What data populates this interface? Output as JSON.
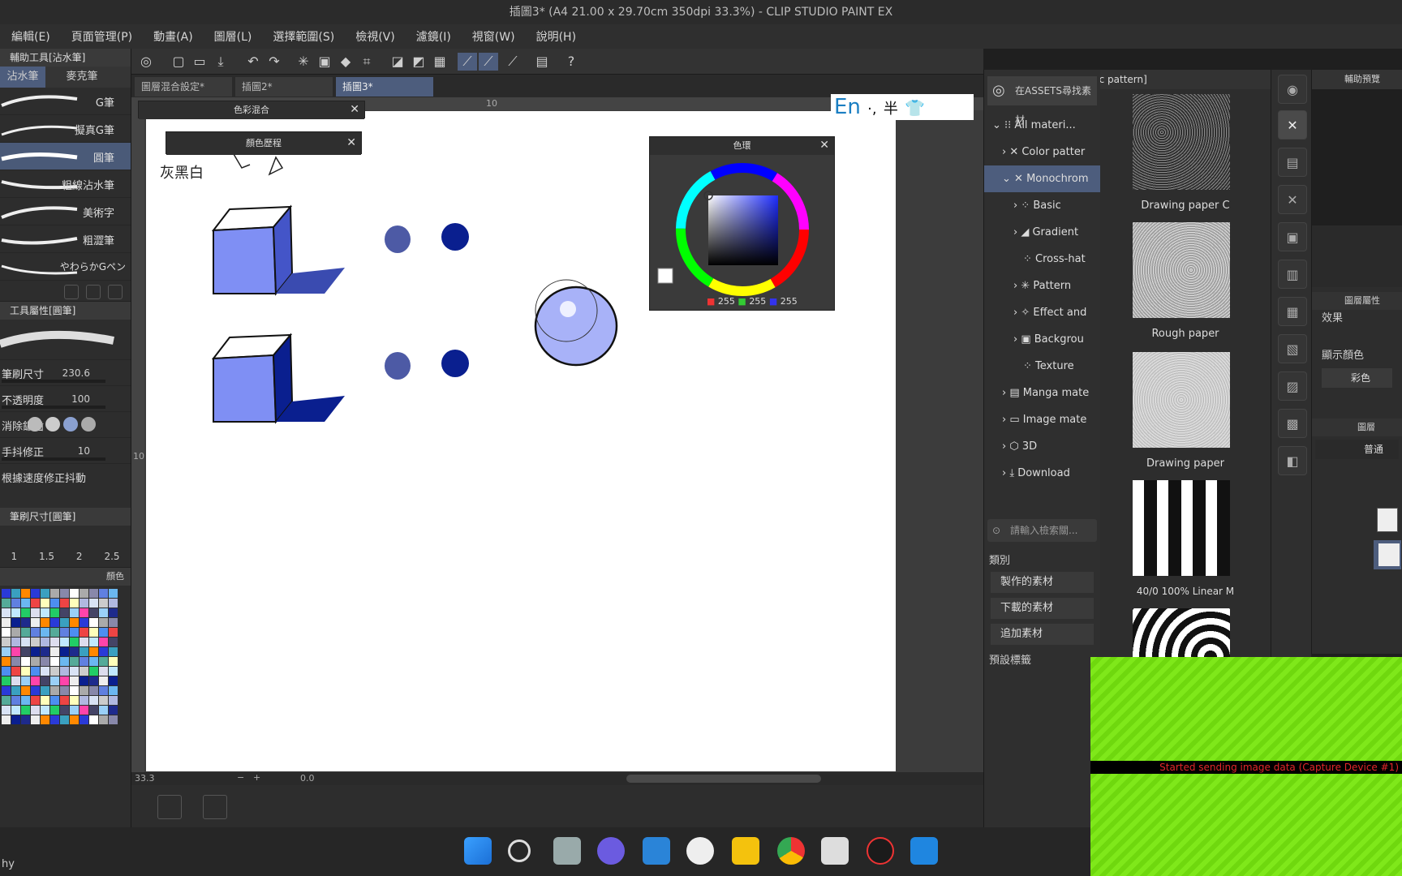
{
  "window": {
    "title": "插圖3* (A4 21.00 x 29.70cm 350dpi 33.3%) - CLIP STUDIO PAINT EX"
  },
  "menu": [
    "編輯(E)",
    "頁面管理(P)",
    "動畫(A)",
    "圖層(L)",
    "選擇範圍(S)",
    "檢視(V)",
    "濾鏡(I)",
    "視窗(W)",
    "說明(H)"
  ],
  "subtool_panel": {
    "title": "輔助工具[沾水筆]",
    "tabs": [
      "沾水筆",
      "麥克筆"
    ],
    "brushes": [
      "G筆",
      "擬真G筆",
      "圓筆",
      "粗線沾水筆",
      "美術字",
      "粗澀筆",
      "やわらかGペン"
    ]
  },
  "tool_property": {
    "title": "工具屬性[圓筆]",
    "rows": [
      {
        "label": "筆刷尺寸",
        "value": "230.6"
      },
      {
        "label": "不透明度",
        "value": "100"
      },
      {
        "label": "消除鋸齒",
        "value": ""
      },
      {
        "label": "手抖修正",
        "value": "10"
      },
      {
        "label": "根據速度修正抖動",
        "value": ""
      }
    ]
  },
  "brush_size_panel": {
    "title": "筆刷尺寸[圓筆]",
    "sizes": [
      "1",
      "1.5",
      "2",
      "2.5"
    ]
  },
  "color_set_panel": {
    "tab": "顏色"
  },
  "doc_tabs": [
    "圖層混合設定*",
    "插圖2*",
    "插圖3*"
  ],
  "ruler": {
    "label": "10",
    "vlabel": "10"
  },
  "float_windows": {
    "color_mix": "色彩混合",
    "color_history": "顏色歷程",
    "color_wheel": "色環"
  },
  "canvas": {
    "note": "灰黑白"
  },
  "ime": {
    "lang": "En",
    "punct": "·,",
    "width": "半"
  },
  "color_wheel": {
    "r": "255",
    "g": "255",
    "b": "255"
  },
  "statusbar": {
    "zoom": "33.3",
    "angle": "0.0"
  },
  "material_panel": {
    "title": "素材[Monochromatic pattern]",
    "assets_button": "在ASSETS尋找素材",
    "tree": [
      "All materi...",
      "Color patter",
      "Monochrom",
      "Basic",
      "Gradient",
      "Cross-hat",
      "Pattern",
      "Effect and",
      "Backgrou",
      "Texture",
      "Manga mate",
      "Image mate",
      "3D",
      "Download"
    ],
    "search_placeholder": "請輸入檢索關...",
    "category_label": "類別",
    "categories": [
      "製作的素材",
      "下載的素材",
      "追加素材"
    ],
    "preset_tag": "預設標籤"
  },
  "thumbnails": [
    "Drawing paper C",
    "Rough paper",
    "Drawing paper",
    "40/0 100% Linear M"
  ],
  "right_panels": {
    "preview_title": "輔助預覽",
    "layer_prop_title": "圖層屬性",
    "effect_label": "效果",
    "display_color_label": "顯示顏色",
    "color_mode": "彩色",
    "layer_title": "圖層",
    "blend_mode": "普通"
  },
  "capture_message": "Started sending image data (Capture Device #1)",
  "taskbar": {
    "left_text": "hy"
  },
  "colors": {
    "accent": "#4d5d7d",
    "panel": "#2d2d2d",
    "cube_fill": "#7f8ff4",
    "dark_blue": "#0a1f8f",
    "green": "#7fe81a",
    "alert_red": "#e2262a"
  }
}
